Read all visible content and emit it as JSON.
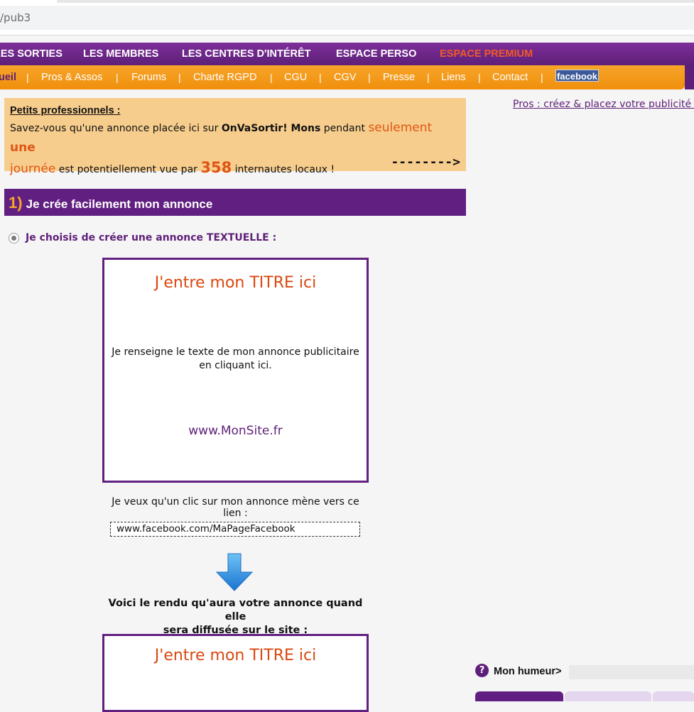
{
  "browser": {
    "url_fragment": "/pub3"
  },
  "top_menu": {
    "items": [
      "LES SORTIES",
      "LES MEMBRES",
      "LES CENTRES D'INTÉRÊT",
      "ESPACE PERSO",
      "ESPACE PREMIUM"
    ]
  },
  "sub_menu": {
    "items": [
      "ueil",
      "Pros & Assos",
      "Forums",
      "Charte RGPD",
      "CGU",
      "CGV",
      "Presse",
      "Liens",
      "Contact"
    ],
    "separator": "|",
    "facebook_label": "facebook"
  },
  "info_box": {
    "heading": "Petits professionnels :",
    "text_1": "Savez-vous qu'une annonce placée ici sur ",
    "brand": "OnVaSortir! Mons",
    "text_2": " pendant ",
    "highlight_1": "seulement ",
    "highlight_2": "une",
    "highlight_3": "journée",
    "text_3": " est potentiellement vue par ",
    "count": "358",
    "text_4": " internautes locaux !",
    "arrow": "-------->"
  },
  "section": {
    "number": "1)",
    "title": "Je crée facilement mon annonce"
  },
  "option": {
    "label": "Je choisis de créer une annonce TEXTUELLE :",
    "selected": true
  },
  "ad_editor": {
    "title": "J'entre mon TITRE ici",
    "text_line_1": "Je renseigne le texte de mon annonce publicitaire",
    "text_line_2": "en cliquant ici.",
    "url": "www.MonSite.fr"
  },
  "link": {
    "label": "Je veux qu'un clic sur mon annonce mène vers ce lien :",
    "value": "www.facebook.com/MaPageFacebook"
  },
  "preview": {
    "label_line_1": "Voici le rendu qu'aura votre annonce quand elle",
    "label_line_2": "sera diffusée sur le site :",
    "title": "J'entre mon TITRE ici"
  },
  "right_column": {
    "pros_link": "Pros : créez & placez votre publicité ici",
    "mood_icon": "?",
    "mood_label": "Mon humeur>"
  },
  "colors": {
    "purple": "#612081",
    "orange": "#f7a52a",
    "premium": "#f05a28",
    "title_orange": "#d9480f",
    "info_bg": "#f7cd8d"
  }
}
